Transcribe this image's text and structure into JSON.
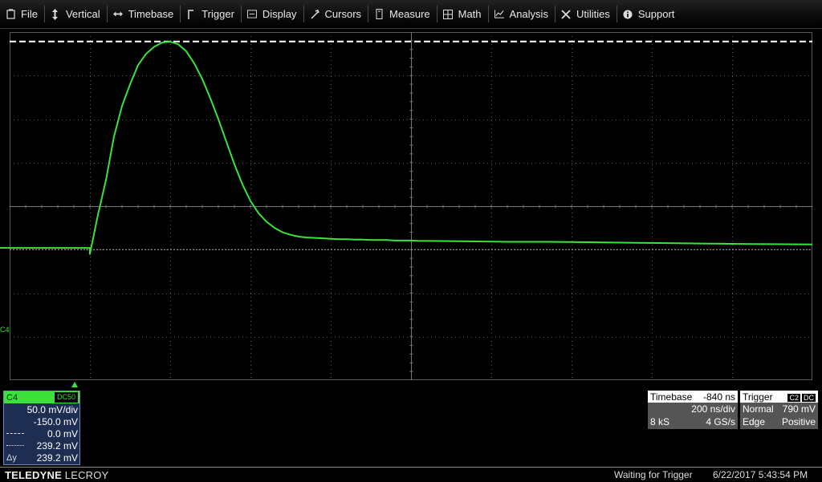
{
  "menu": [
    {
      "label": "File",
      "icon": "file-icon"
    },
    {
      "label": "Vertical",
      "icon": "vertical-arrows-icon"
    },
    {
      "label": "Timebase",
      "icon": "horizontal-arrows-icon"
    },
    {
      "label": "Trigger",
      "icon": "trigger-icon"
    },
    {
      "label": "Display",
      "icon": "display-icon"
    },
    {
      "label": "Cursors",
      "icon": "cursor-icon"
    },
    {
      "label": "Measure",
      "icon": "measure-icon"
    },
    {
      "label": "Math",
      "icon": "calculator-icon"
    },
    {
      "label": "Analysis",
      "icon": "analysis-chart-icon"
    },
    {
      "label": "Utilities",
      "icon": "tools-icon"
    },
    {
      "label": "Support",
      "icon": "info-icon"
    }
  ],
  "display": {
    "channel_label": "C4",
    "trace_color": "#3be23b",
    "grid_color": "#5a5a5a",
    "cursor_color": "#ffffff"
  },
  "channel": {
    "name": "C4",
    "coupling": "DC50",
    "vdiv": "50.0 mV/div",
    "offset": "-150.0 mV",
    "cursor1": "0.0 mV",
    "cursor2": "239.2 mV",
    "delta_label": "Δy",
    "delta": "239.2 mV"
  },
  "timebase": {
    "label": "Timebase",
    "delay": "-840 ns",
    "tdiv": "200 ns/div",
    "points": "8 kS",
    "rate": "4 GS/s"
  },
  "trigger": {
    "label": "Trigger",
    "source": "C2",
    "coupling": "DC",
    "mode": "Normal",
    "level": "790 mV",
    "type": "Edge",
    "slope": "Positive"
  },
  "status": {
    "brand_bold": "TELEDYNE",
    "brand_light": "LECROY",
    "state": "Waiting for Trigger",
    "datetime": "6/22/2017 5:43:54 PM"
  },
  "chart_data": {
    "type": "line",
    "x_unit": "ns",
    "y_unit": "mV",
    "xlim": [
      -1040,
      960
    ],
    "ylim": [
      -150,
      250
    ],
    "cursors_y": [
      0,
      239.2
    ],
    "series": [
      {
        "x": [
          -1040,
          -840,
          -840,
          -820,
          -800,
          -780,
          -760,
          -740,
          -720,
          -700,
          -680,
          -660,
          -640,
          -620,
          -600,
          -580,
          -560,
          -540,
          -520,
          -500,
          -480,
          -460,
          -440,
          -420,
          -400,
          -380,
          -360,
          -340,
          -320,
          -300,
          -280,
          -260,
          -240,
          -220,
          -200,
          -180,
          -160,
          -140,
          -120,
          -100,
          -80,
          -60,
          -40,
          -20,
          0,
          100,
          200,
          300,
          400,
          500,
          600,
          700,
          800,
          960
        ],
        "y": [
          2,
          2,
          -5,
          40,
          80,
          130,
          165,
          190,
          212,
          225,
          233,
          238,
          239,
          236,
          228,
          214,
          196,
          174,
          150,
          124,
          98,
          75,
          56,
          42,
          32,
          25,
          20,
          17,
          15,
          14,
          13.5,
          13,
          12.5,
          12,
          12,
          11.5,
          11.5,
          11,
          11,
          11,
          10.5,
          10.5,
          10.5,
          10,
          10,
          9.5,
          9,
          9,
          8.5,
          8,
          7.5,
          7,
          6.5,
          6
        ]
      }
    ]
  }
}
